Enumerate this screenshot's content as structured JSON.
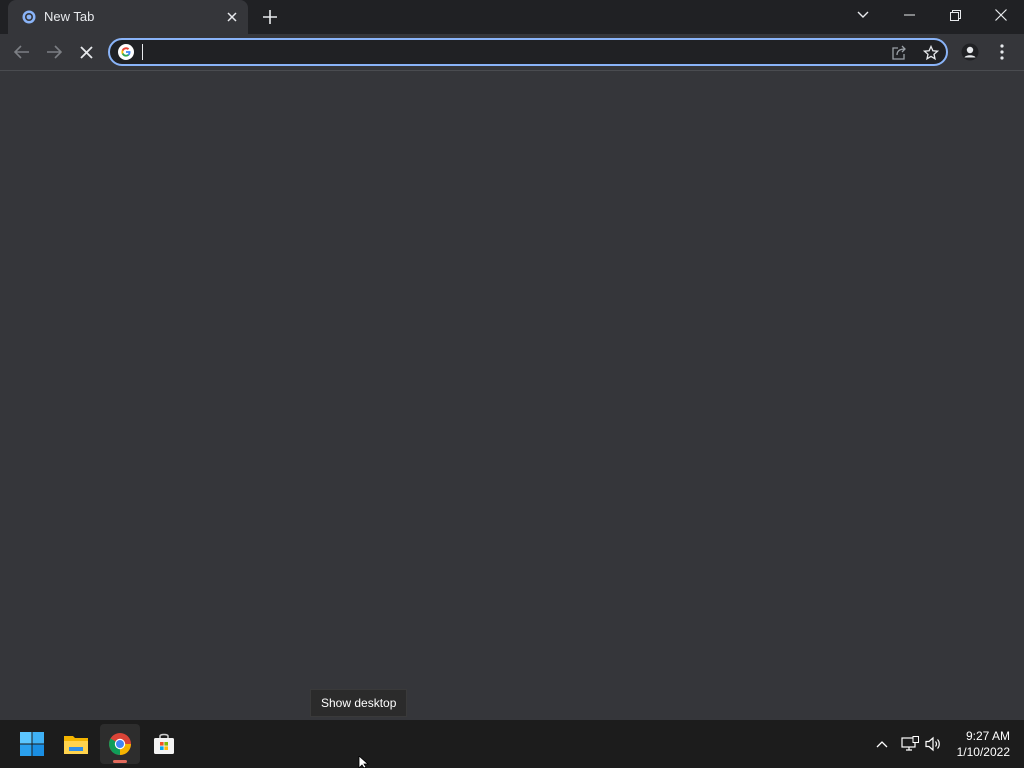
{
  "browser": {
    "tab": {
      "title": "New Tab"
    },
    "omnibox": {
      "value": "",
      "placeholder": ""
    }
  },
  "icons": {
    "favicon": "chrome-newtab-icon",
    "close": "close-icon",
    "new_tab": "plus-icon",
    "tab_search": "chevron-down-icon",
    "minimize": "minimize-icon",
    "restore": "restore-icon",
    "window_close": "close-icon",
    "back": "arrow-left-icon",
    "forward": "arrow-right-icon",
    "stop": "stop-icon",
    "search_engine": "google-icon",
    "share": "share-icon",
    "bookmark": "star-icon",
    "profile": "profile-icon",
    "menu": "kebab-menu-icon"
  },
  "tooltip": {
    "text": "Show desktop"
  },
  "taskbar": {
    "apps": [
      "start-button",
      "file-explorer",
      "google-chrome",
      "microsoft-store"
    ],
    "time": "9:27 AM",
    "date": "1/10/2022"
  },
  "colors": {
    "accent": "#8ab4f8",
    "frame": "#202124",
    "toolbar": "#35363a",
    "taskbar": "#1c1c1c",
    "active_indicator": "#e36b5d"
  }
}
